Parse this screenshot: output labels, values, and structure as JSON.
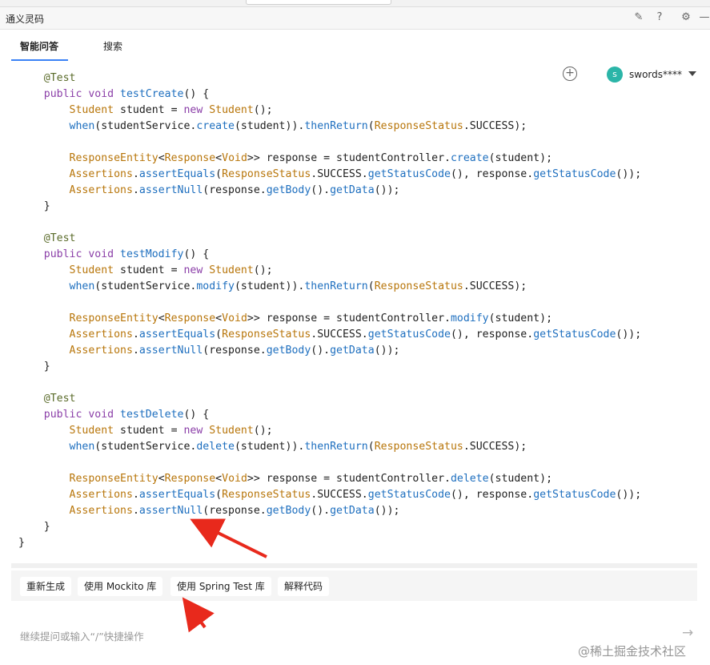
{
  "window": {
    "title": "通义灵码"
  },
  "titlebar_icons": [
    "edit-icon",
    "help-icon",
    "gear-icon",
    "minimize-icon"
  ],
  "tabs": [
    {
      "label": "智能问答",
      "active": true
    },
    {
      "label": "搜索",
      "active": false
    }
  ],
  "header": {
    "user_initial": "s",
    "username": "swords****"
  },
  "code_lines": [
    [
      {
        "t": "    "
      },
      {
        "t": "@Test",
        "c": "ann"
      }
    ],
    [
      {
        "t": "    "
      },
      {
        "t": "public void ",
        "c": "kw"
      },
      {
        "t": "testCreate",
        "c": "fn"
      },
      {
        "t": "() {"
      }
    ],
    [
      {
        "t": "        "
      },
      {
        "t": "Student",
        "c": "cls"
      },
      {
        "t": " student = "
      },
      {
        "t": "new ",
        "c": "kw"
      },
      {
        "t": "Student",
        "c": "cls"
      },
      {
        "t": "();"
      }
    ],
    [
      {
        "t": "        "
      },
      {
        "t": "when",
        "c": "fn"
      },
      {
        "t": "(studentService."
      },
      {
        "t": "create",
        "c": "fn"
      },
      {
        "t": "(student))."
      },
      {
        "t": "thenReturn",
        "c": "fn"
      },
      {
        "t": "("
      },
      {
        "t": "ResponseStatus",
        "c": "cls"
      },
      {
        "t": ".SUCCESS);"
      }
    ],
    [
      {
        "t": ""
      }
    ],
    [
      {
        "t": "        "
      },
      {
        "t": "ResponseEntity",
        "c": "cls"
      },
      {
        "t": "<"
      },
      {
        "t": "Response",
        "c": "cls"
      },
      {
        "t": "<"
      },
      {
        "t": "Void",
        "c": "cls"
      },
      {
        "t": ">> response = studentController."
      },
      {
        "t": "create",
        "c": "fn"
      },
      {
        "t": "(student);"
      }
    ],
    [
      {
        "t": "        "
      },
      {
        "t": "Assertions",
        "c": "cls"
      },
      {
        "t": "."
      },
      {
        "t": "assertEquals",
        "c": "fn"
      },
      {
        "t": "("
      },
      {
        "t": "ResponseStatus",
        "c": "cls"
      },
      {
        "t": ".SUCCESS."
      },
      {
        "t": "getStatusCode",
        "c": "fn"
      },
      {
        "t": "(), response."
      },
      {
        "t": "getStatusCode",
        "c": "fn"
      },
      {
        "t": "());"
      }
    ],
    [
      {
        "t": "        "
      },
      {
        "t": "Assertions",
        "c": "cls"
      },
      {
        "t": "."
      },
      {
        "t": "assertNull",
        "c": "fn"
      },
      {
        "t": "(response."
      },
      {
        "t": "getBody",
        "c": "fn"
      },
      {
        "t": "()."
      },
      {
        "t": "getData",
        "c": "fn"
      },
      {
        "t": "());"
      }
    ],
    [
      {
        "t": "    }"
      }
    ],
    [
      {
        "t": ""
      }
    ],
    [
      {
        "t": "    "
      },
      {
        "t": "@Test",
        "c": "ann"
      }
    ],
    [
      {
        "t": "    "
      },
      {
        "t": "public void ",
        "c": "kw"
      },
      {
        "t": "testModify",
        "c": "fn"
      },
      {
        "t": "() {"
      }
    ],
    [
      {
        "t": "        "
      },
      {
        "t": "Student",
        "c": "cls"
      },
      {
        "t": " student = "
      },
      {
        "t": "new ",
        "c": "kw"
      },
      {
        "t": "Student",
        "c": "cls"
      },
      {
        "t": "();"
      }
    ],
    [
      {
        "t": "        "
      },
      {
        "t": "when",
        "c": "fn"
      },
      {
        "t": "(studentService."
      },
      {
        "t": "modify",
        "c": "fn"
      },
      {
        "t": "(student))."
      },
      {
        "t": "thenReturn",
        "c": "fn"
      },
      {
        "t": "("
      },
      {
        "t": "ResponseStatus",
        "c": "cls"
      },
      {
        "t": ".SUCCESS);"
      }
    ],
    [
      {
        "t": ""
      }
    ],
    [
      {
        "t": "        "
      },
      {
        "t": "ResponseEntity",
        "c": "cls"
      },
      {
        "t": "<"
      },
      {
        "t": "Response",
        "c": "cls"
      },
      {
        "t": "<"
      },
      {
        "t": "Void",
        "c": "cls"
      },
      {
        "t": ">> response = studentController."
      },
      {
        "t": "modify",
        "c": "fn"
      },
      {
        "t": "(student);"
      }
    ],
    [
      {
        "t": "        "
      },
      {
        "t": "Assertions",
        "c": "cls"
      },
      {
        "t": "."
      },
      {
        "t": "assertEquals",
        "c": "fn"
      },
      {
        "t": "("
      },
      {
        "t": "ResponseStatus",
        "c": "cls"
      },
      {
        "t": ".SUCCESS."
      },
      {
        "t": "getStatusCode",
        "c": "fn"
      },
      {
        "t": "(), response."
      },
      {
        "t": "getStatusCode",
        "c": "fn"
      },
      {
        "t": "());"
      }
    ],
    [
      {
        "t": "        "
      },
      {
        "t": "Assertions",
        "c": "cls"
      },
      {
        "t": "."
      },
      {
        "t": "assertNull",
        "c": "fn"
      },
      {
        "t": "(response."
      },
      {
        "t": "getBody",
        "c": "fn"
      },
      {
        "t": "()."
      },
      {
        "t": "getData",
        "c": "fn"
      },
      {
        "t": "());"
      }
    ],
    [
      {
        "t": "    }"
      }
    ],
    [
      {
        "t": ""
      }
    ],
    [
      {
        "t": "    "
      },
      {
        "t": "@Test",
        "c": "ann"
      }
    ],
    [
      {
        "t": "    "
      },
      {
        "t": "public void ",
        "c": "kw"
      },
      {
        "t": "testDelete",
        "c": "fn"
      },
      {
        "t": "() {"
      }
    ],
    [
      {
        "t": "        "
      },
      {
        "t": "Student",
        "c": "cls"
      },
      {
        "t": " student = "
      },
      {
        "t": "new ",
        "c": "kw"
      },
      {
        "t": "Student",
        "c": "cls"
      },
      {
        "t": "();"
      }
    ],
    [
      {
        "t": "        "
      },
      {
        "t": "when",
        "c": "fn"
      },
      {
        "t": "(studentService."
      },
      {
        "t": "delete",
        "c": "fn"
      },
      {
        "t": "(student))."
      },
      {
        "t": "thenReturn",
        "c": "fn"
      },
      {
        "t": "("
      },
      {
        "t": "ResponseStatus",
        "c": "cls"
      },
      {
        "t": ".SUCCESS);"
      }
    ],
    [
      {
        "t": ""
      }
    ],
    [
      {
        "t": "        "
      },
      {
        "t": "ResponseEntity",
        "c": "cls"
      },
      {
        "t": "<"
      },
      {
        "t": "Response",
        "c": "cls"
      },
      {
        "t": "<"
      },
      {
        "t": "Void",
        "c": "cls"
      },
      {
        "t": ">> response = studentController."
      },
      {
        "t": "delete",
        "c": "fn"
      },
      {
        "t": "(student);"
      }
    ],
    [
      {
        "t": "        "
      },
      {
        "t": "Assertions",
        "c": "cls"
      },
      {
        "t": "."
      },
      {
        "t": "assertEquals",
        "c": "fn"
      },
      {
        "t": "("
      },
      {
        "t": "ResponseStatus",
        "c": "cls"
      },
      {
        "t": ".SUCCESS."
      },
      {
        "t": "getStatusCode",
        "c": "fn"
      },
      {
        "t": "(), response."
      },
      {
        "t": "getStatusCode",
        "c": "fn"
      },
      {
        "t": "());"
      }
    ],
    [
      {
        "t": "        "
      },
      {
        "t": "Assertions",
        "c": "cls"
      },
      {
        "t": "."
      },
      {
        "t": "assertNull",
        "c": "fn"
      },
      {
        "t": "(response."
      },
      {
        "t": "getBody",
        "c": "fn"
      },
      {
        "t": "()."
      },
      {
        "t": "getData",
        "c": "fn"
      },
      {
        "t": "());"
      }
    ],
    [
      {
        "t": "    }"
      }
    ],
    [
      {
        "t": "}"
      }
    ]
  ],
  "actions": [
    "重新生成",
    "使用 Mockito 库",
    "使用 Spring Test 库",
    "解释代码"
  ],
  "input": {
    "placeholder": "继续提问或输入“/”快捷操作"
  },
  "watermark": "@稀土掘金技术社区",
  "colors": {
    "accent": "#3b82f6",
    "annotation_arrow": "#e8291c",
    "avatar": "#2bb5a8"
  }
}
